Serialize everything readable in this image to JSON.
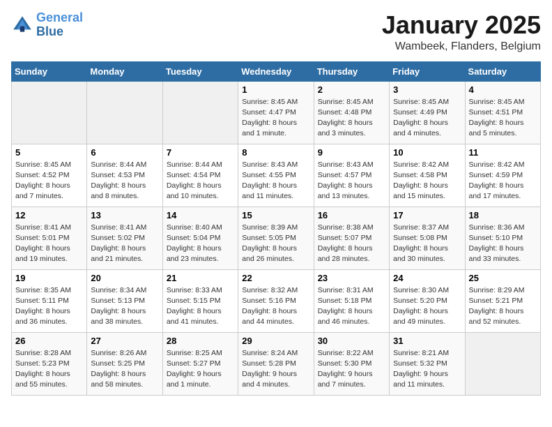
{
  "logo": {
    "line1": "General",
    "line2": "Blue"
  },
  "title": "January 2025",
  "subtitle": "Wambeek, Flanders, Belgium",
  "weekdays": [
    "Sunday",
    "Monday",
    "Tuesday",
    "Wednesday",
    "Thursday",
    "Friday",
    "Saturday"
  ],
  "weeks": [
    [
      {
        "day": "",
        "sunrise": "",
        "sunset": "",
        "daylight": ""
      },
      {
        "day": "",
        "sunrise": "",
        "sunset": "",
        "daylight": ""
      },
      {
        "day": "",
        "sunrise": "",
        "sunset": "",
        "daylight": ""
      },
      {
        "day": "1",
        "sunrise": "Sunrise: 8:45 AM",
        "sunset": "Sunset: 4:47 PM",
        "daylight": "Daylight: 8 hours and 1 minute."
      },
      {
        "day": "2",
        "sunrise": "Sunrise: 8:45 AM",
        "sunset": "Sunset: 4:48 PM",
        "daylight": "Daylight: 8 hours and 3 minutes."
      },
      {
        "day": "3",
        "sunrise": "Sunrise: 8:45 AM",
        "sunset": "Sunset: 4:49 PM",
        "daylight": "Daylight: 8 hours and 4 minutes."
      },
      {
        "day": "4",
        "sunrise": "Sunrise: 8:45 AM",
        "sunset": "Sunset: 4:51 PM",
        "daylight": "Daylight: 8 hours and 5 minutes."
      }
    ],
    [
      {
        "day": "5",
        "sunrise": "Sunrise: 8:45 AM",
        "sunset": "Sunset: 4:52 PM",
        "daylight": "Daylight: 8 hours and 7 minutes."
      },
      {
        "day": "6",
        "sunrise": "Sunrise: 8:44 AM",
        "sunset": "Sunset: 4:53 PM",
        "daylight": "Daylight: 8 hours and 8 minutes."
      },
      {
        "day": "7",
        "sunrise": "Sunrise: 8:44 AM",
        "sunset": "Sunset: 4:54 PM",
        "daylight": "Daylight: 8 hours and 10 minutes."
      },
      {
        "day": "8",
        "sunrise": "Sunrise: 8:43 AM",
        "sunset": "Sunset: 4:55 PM",
        "daylight": "Daylight: 8 hours and 11 minutes."
      },
      {
        "day": "9",
        "sunrise": "Sunrise: 8:43 AM",
        "sunset": "Sunset: 4:57 PM",
        "daylight": "Daylight: 8 hours and 13 minutes."
      },
      {
        "day": "10",
        "sunrise": "Sunrise: 8:42 AM",
        "sunset": "Sunset: 4:58 PM",
        "daylight": "Daylight: 8 hours and 15 minutes."
      },
      {
        "day": "11",
        "sunrise": "Sunrise: 8:42 AM",
        "sunset": "Sunset: 4:59 PM",
        "daylight": "Daylight: 8 hours and 17 minutes."
      }
    ],
    [
      {
        "day": "12",
        "sunrise": "Sunrise: 8:41 AM",
        "sunset": "Sunset: 5:01 PM",
        "daylight": "Daylight: 8 hours and 19 minutes."
      },
      {
        "day": "13",
        "sunrise": "Sunrise: 8:41 AM",
        "sunset": "Sunset: 5:02 PM",
        "daylight": "Daylight: 8 hours and 21 minutes."
      },
      {
        "day": "14",
        "sunrise": "Sunrise: 8:40 AM",
        "sunset": "Sunset: 5:04 PM",
        "daylight": "Daylight: 8 hours and 23 minutes."
      },
      {
        "day": "15",
        "sunrise": "Sunrise: 8:39 AM",
        "sunset": "Sunset: 5:05 PM",
        "daylight": "Daylight: 8 hours and 26 minutes."
      },
      {
        "day": "16",
        "sunrise": "Sunrise: 8:38 AM",
        "sunset": "Sunset: 5:07 PM",
        "daylight": "Daylight: 8 hours and 28 minutes."
      },
      {
        "day": "17",
        "sunrise": "Sunrise: 8:37 AM",
        "sunset": "Sunset: 5:08 PM",
        "daylight": "Daylight: 8 hours and 30 minutes."
      },
      {
        "day": "18",
        "sunrise": "Sunrise: 8:36 AM",
        "sunset": "Sunset: 5:10 PM",
        "daylight": "Daylight: 8 hours and 33 minutes."
      }
    ],
    [
      {
        "day": "19",
        "sunrise": "Sunrise: 8:35 AM",
        "sunset": "Sunset: 5:11 PM",
        "daylight": "Daylight: 8 hours and 36 minutes."
      },
      {
        "day": "20",
        "sunrise": "Sunrise: 8:34 AM",
        "sunset": "Sunset: 5:13 PM",
        "daylight": "Daylight: 8 hours and 38 minutes."
      },
      {
        "day": "21",
        "sunrise": "Sunrise: 8:33 AM",
        "sunset": "Sunset: 5:15 PM",
        "daylight": "Daylight: 8 hours and 41 minutes."
      },
      {
        "day": "22",
        "sunrise": "Sunrise: 8:32 AM",
        "sunset": "Sunset: 5:16 PM",
        "daylight": "Daylight: 8 hours and 44 minutes."
      },
      {
        "day": "23",
        "sunrise": "Sunrise: 8:31 AM",
        "sunset": "Sunset: 5:18 PM",
        "daylight": "Daylight: 8 hours and 46 minutes."
      },
      {
        "day": "24",
        "sunrise": "Sunrise: 8:30 AM",
        "sunset": "Sunset: 5:20 PM",
        "daylight": "Daylight: 8 hours and 49 minutes."
      },
      {
        "day": "25",
        "sunrise": "Sunrise: 8:29 AM",
        "sunset": "Sunset: 5:21 PM",
        "daylight": "Daylight: 8 hours and 52 minutes."
      }
    ],
    [
      {
        "day": "26",
        "sunrise": "Sunrise: 8:28 AM",
        "sunset": "Sunset: 5:23 PM",
        "daylight": "Daylight: 8 hours and 55 minutes."
      },
      {
        "day": "27",
        "sunrise": "Sunrise: 8:26 AM",
        "sunset": "Sunset: 5:25 PM",
        "daylight": "Daylight: 8 hours and 58 minutes."
      },
      {
        "day": "28",
        "sunrise": "Sunrise: 8:25 AM",
        "sunset": "Sunset: 5:27 PM",
        "daylight": "Daylight: 9 hours and 1 minute."
      },
      {
        "day": "29",
        "sunrise": "Sunrise: 8:24 AM",
        "sunset": "Sunset: 5:28 PM",
        "daylight": "Daylight: 9 hours and 4 minutes."
      },
      {
        "day": "30",
        "sunrise": "Sunrise: 8:22 AM",
        "sunset": "Sunset: 5:30 PM",
        "daylight": "Daylight: 9 hours and 7 minutes."
      },
      {
        "day": "31",
        "sunrise": "Sunrise: 8:21 AM",
        "sunset": "Sunset: 5:32 PM",
        "daylight": "Daylight: 9 hours and 11 minutes."
      },
      {
        "day": "",
        "sunrise": "",
        "sunset": "",
        "daylight": ""
      }
    ]
  ]
}
